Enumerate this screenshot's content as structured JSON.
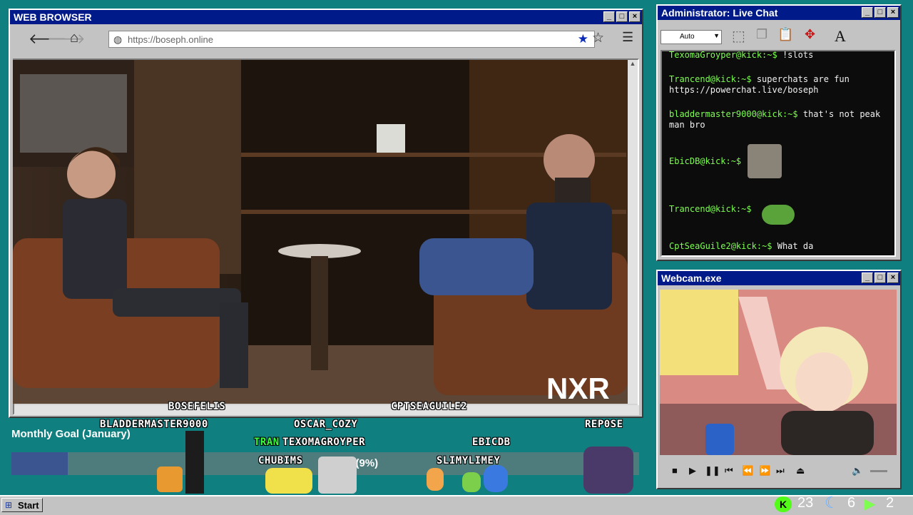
{
  "browser": {
    "title": "WEB BROWSER",
    "url": "https://boseph.online",
    "overlay_logo": "NXR"
  },
  "chat": {
    "title": "Administrator: Live Chat",
    "dropdown_value": "Auto",
    "messages": [
      {
        "user": "TexomaGroyper@kick:~$",
        "text": "!slots"
      },
      {
        "user": "Trancend@kick:~$",
        "text": "superchats are fun https://powerchat.live/boseph"
      },
      {
        "user": "bladdermaster9000@kick:~$",
        "text": "that's not peak man bro"
      },
      {
        "user": "EbicDB@kick:~$",
        "text": ""
      },
      {
        "user": "Trancend@kick:~$",
        "text": ""
      },
      {
        "user": "CptSeaGuile2@kick:~$",
        "text": "What da"
      }
    ]
  },
  "webcam": {
    "title": "Webcam.exe"
  },
  "goal": {
    "label": "Monthly Goal (January)",
    "percent_text": "0 (9%)",
    "progress": 0.09
  },
  "overlay_names": [
    "BOSEFELIS",
    "CPTSEAGUILE2",
    "BLADDERMASTER9000",
    "OSCAR_COZY",
    "REP0SE",
    "TEXOMAGROYPER",
    "EBICDB",
    "CHUBIMS",
    "SLIMYLIMEY",
    "TRAN"
  ],
  "taskbar": {
    "start_label": "Start",
    "counters": [
      {
        "icon": "kick-icon",
        "value": "23",
        "color": "#53fc18"
      },
      {
        "icon": "moon-icon",
        "value": "6",
        "color": "#6ab0ff"
      },
      {
        "icon": "play-icon",
        "value": "2",
        "color": "#7cff4f"
      }
    ]
  }
}
